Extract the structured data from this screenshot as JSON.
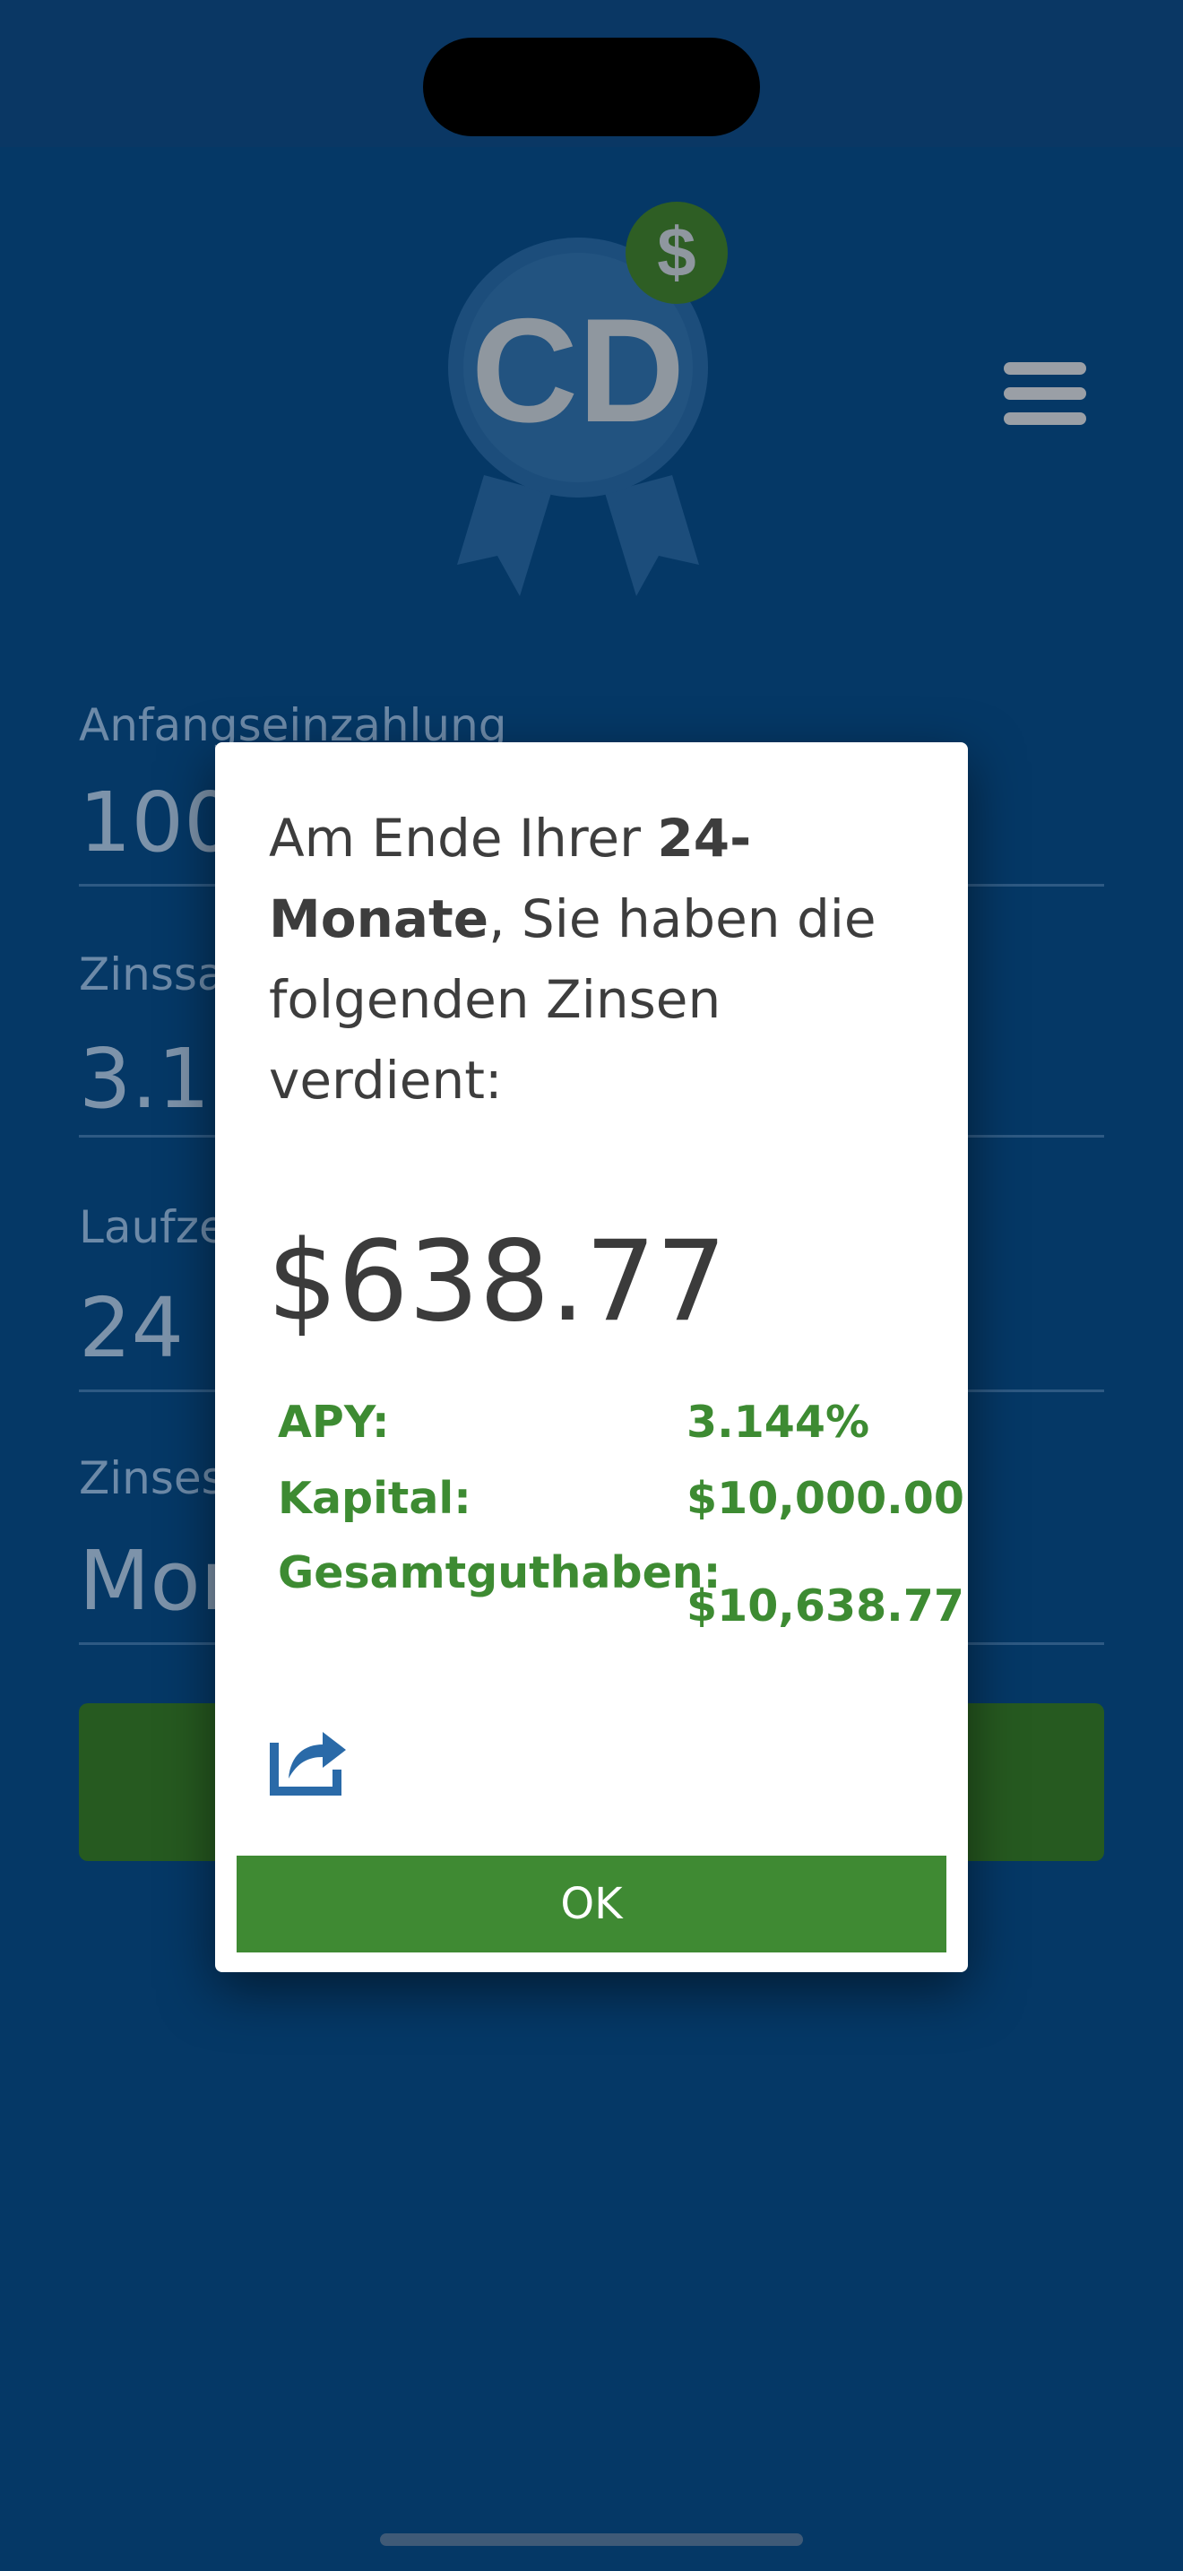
{
  "form": {
    "deposit": {
      "label": "Anfangseinzahlung",
      "value": "10000"
    },
    "rate": {
      "label": "Zinssatz",
      "value": "3.10"
    },
    "term": {
      "label": "Laufzeit",
      "value": "24"
    },
    "compounding": {
      "label": "Zinseszins",
      "value": "Monatlich"
    }
  },
  "logo": {
    "text": "CD",
    "badge": "$"
  },
  "dialog": {
    "message_pre": "Am Ende Ihrer ",
    "message_bold": "24-Monate",
    "message_post": ", Sie haben die folgenden Zinsen verdient:",
    "amount": "$638.77",
    "details": [
      {
        "label": "APY:",
        "value": "3.144%"
      },
      {
        "label": "Kapital:",
        "value": "$10,000.00"
      },
      {
        "label": "Gesamtguthaben:",
        "value": "$10,638.77"
      }
    ],
    "ok_label": "OK"
  },
  "colors": {
    "background": "#053866",
    "accent_green": "#3f8a33",
    "detail_green": "#3d8b32",
    "share_icon_blue": "#2a6aa8"
  },
  "icons": {
    "menu": "hamburger-icon",
    "share": "share-icon",
    "logo": "cd-ribbon-logo"
  }
}
